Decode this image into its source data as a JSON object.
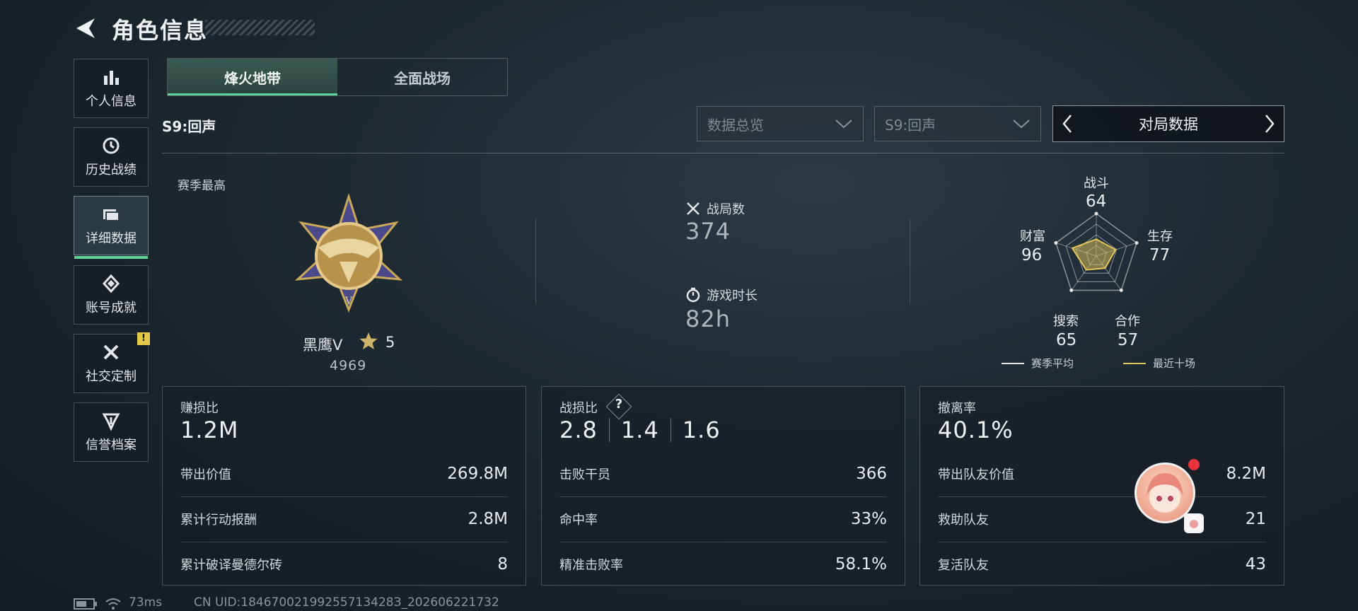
{
  "header": {
    "title": "角色信息"
  },
  "sidebar": {
    "items": [
      {
        "label": "个人信息",
        "icon": "bar-chart-icon"
      },
      {
        "label": "历史战绩",
        "icon": "history-icon"
      },
      {
        "label": "详细数据",
        "icon": "folder-icon",
        "active": true
      },
      {
        "label": "账号成就",
        "icon": "achievement-icon"
      },
      {
        "label": "社交定制",
        "icon": "tools-icon",
        "badge": "!"
      },
      {
        "label": "信誉档案",
        "icon": "credit-icon"
      }
    ]
  },
  "tabs": [
    {
      "label": "烽火地带",
      "active": true
    },
    {
      "label": "全面战场",
      "active": false
    }
  ],
  "season_label": "S9:回声",
  "filters": {
    "data_type": "数据总览",
    "season": "S9:回声",
    "pager_label": "对局数据"
  },
  "season_best": {
    "title": "赛季最高",
    "rank_name": "黑鹰V",
    "stars": "5",
    "score": "4969"
  },
  "stats": {
    "matches_label": "战局数",
    "matches_value": "374",
    "playtime_label": "游戏时长",
    "playtime_value": "82h"
  },
  "radar": {
    "axes": [
      {
        "label": "战斗",
        "value": "64"
      },
      {
        "label": "生存",
        "value": "77"
      },
      {
        "label": "合作",
        "value": "57"
      },
      {
        "label": "搜索",
        "value": "65"
      },
      {
        "label": "财富",
        "value": "96"
      }
    ],
    "recent_values": [
      64,
      77,
      57,
      65,
      96
    ],
    "legend": {
      "season_avg": "赛季平均",
      "recent": "最近十场"
    },
    "colors": {
      "season_avg": "#e6e6e6",
      "recent": "#e2c55a"
    }
  },
  "cards": {
    "profit": {
      "title": "赚损比",
      "big": "1.2M",
      "rows": [
        {
          "label": "带出价值",
          "value": "269.8M"
        },
        {
          "label": "累计行动报酬",
          "value": "2.8M"
        },
        {
          "label": "累计破译曼德尔砖",
          "value": "8"
        }
      ]
    },
    "kd": {
      "title": "战损比",
      "help": "?",
      "values": [
        "2.8",
        "1.4",
        "1.6"
      ],
      "rows": [
        {
          "label": "击败干员",
          "value": "366"
        },
        {
          "label": "命中率",
          "value": "33%"
        },
        {
          "label": "精准击败率",
          "value": "58.1%"
        }
      ]
    },
    "extract": {
      "title": "撤离率",
      "big": "40.1%",
      "rows": [
        {
          "label": "带出队友价值",
          "value": "8.2M"
        },
        {
          "label": "救助队友",
          "value": "21"
        },
        {
          "label": "复活队友",
          "value": "43"
        }
      ]
    }
  },
  "status_bar": {
    "ping": "73ms",
    "uid": "CN UID:18467002199255713428З_202606221732"
  },
  "accent_color": "#5fd39a"
}
